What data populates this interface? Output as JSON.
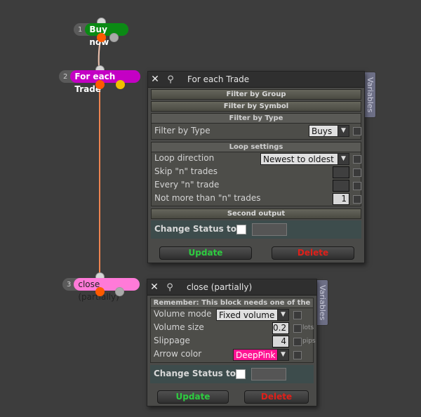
{
  "nodes": [
    {
      "num": "1",
      "label": "Buy now",
      "color": "#0b8a14"
    },
    {
      "num": "2",
      "label": "For each Trade",
      "color": "#c400c4"
    },
    {
      "num": "3",
      "label": "close (partially)",
      "color": "#ff7ad8"
    }
  ],
  "panel1": {
    "title": "For each Trade",
    "tab": "Variables",
    "sections": {
      "filter_group": "Filter by Group",
      "filter_symbol": "Filter by Symbol",
      "filter_type": "Filter by Type",
      "loop_settings": "Loop settings",
      "second_output": "Second output"
    },
    "filter_type_label": "Filter by Type",
    "filter_type_value": "Buys",
    "loop_direction_label": "Loop direction",
    "loop_direction_value": "Newest to oldest",
    "skip_label": "Skip \"n\" trades",
    "skip_value": "",
    "every_label": "Every \"n\" trade",
    "every_value": "",
    "notmore_label": "Not more than \"n\" trades",
    "notmore_value": "1",
    "change_status": "Change Status to",
    "update": "Update",
    "delete": "Delete"
  },
  "panel2": {
    "title": "close (partially)",
    "tab": "Variables",
    "remember": "Remember: This block needs one of the",
    "volume_mode_label": "Volume mode",
    "volume_mode_value": "Fixed volume",
    "volume_size_label": "Volume size",
    "volume_size_value": "0.2",
    "volume_unit": "lots",
    "slippage_label": "Slippage",
    "slippage_value": "4",
    "slippage_unit": "pips",
    "arrow_color_label": "Arrow color",
    "arrow_color_value": "DeepPink",
    "arrow_color_hex": "#ff1493",
    "change_status": "Change Status to",
    "update": "Update",
    "delete": "Delete"
  }
}
